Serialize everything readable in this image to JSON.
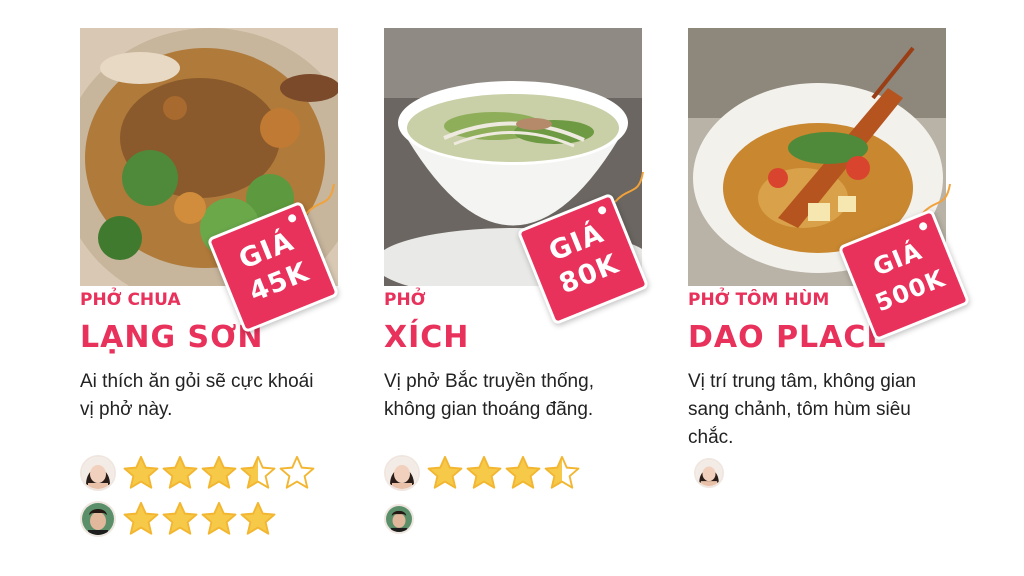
{
  "cards": [
    {
      "price_tag": {
        "label": "GIÁ",
        "value": "45K"
      },
      "subtitle": "PHỞ CHUA",
      "title": "LẠNG SƠN",
      "description": "Ai thích ăn gỏi sẽ cực khoái vị phở này.",
      "ratings": [
        {
          "reviewer": "female-reviewer",
          "stars": 3.5,
          "max_stars": 5
        },
        {
          "reviewer": "male-reviewer",
          "stars": 4,
          "max_stars": 4
        }
      ]
    },
    {
      "price_tag": {
        "label": "GIÁ",
        "value": "80K"
      },
      "subtitle": "PHỞ",
      "title": "XÍCH",
      "description": "Vị phở Bắc truyền thống, không gian thoáng đãng.",
      "ratings": [
        {
          "reviewer": "female-reviewer",
          "stars": 3.5,
          "max_stars": 4
        },
        {
          "reviewer": "male-reviewer",
          "stars": 0,
          "max_stars": 0
        }
      ]
    },
    {
      "price_tag": {
        "label": "GIÁ",
        "value": "500K"
      },
      "subtitle": "PHỞ TÔM HÙM",
      "title": "DAO PLACE",
      "description": "Vị trí trung tâm, không gian sang chảnh, tôm hùm siêu chắc.",
      "ratings": [
        {
          "reviewer": "female-reviewer",
          "stars": 0,
          "max_stars": 0
        }
      ]
    }
  ],
  "colors": {
    "accent": "#e8315b",
    "star_fill": "#f7c948",
    "star_outline": "#f2b631",
    "text": "#222222"
  },
  "icons": [
    "price-tag-icon",
    "star-icon",
    "half-star-icon",
    "empty-star-icon",
    "avatar-icon"
  ]
}
